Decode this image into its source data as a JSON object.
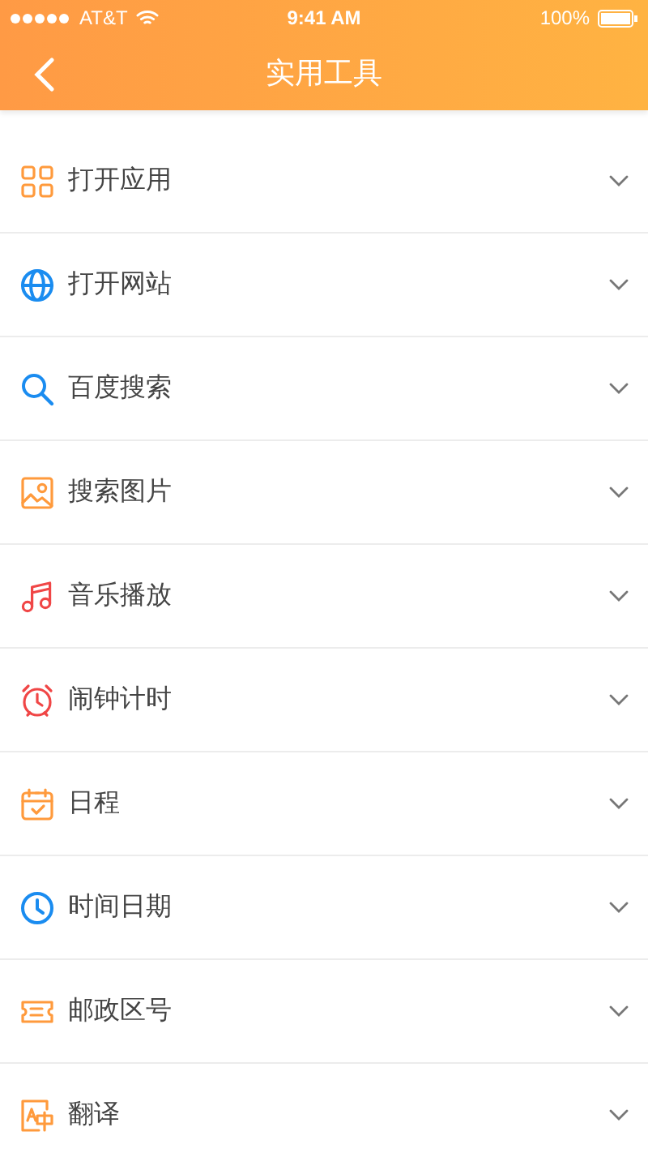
{
  "status_bar": {
    "carrier": "AT&T",
    "time": "9:41 AM",
    "battery": "100%"
  },
  "nav": {
    "title": "实用工具"
  },
  "items": [
    {
      "kind": "apps",
      "label": "打开应用",
      "color": "#ff9a3c"
    },
    {
      "kind": "globe",
      "label": "打开网站",
      "color": "#1a8cf0"
    },
    {
      "kind": "search",
      "label": "百度搜索",
      "color": "#1a8cf0"
    },
    {
      "kind": "image",
      "label": "搜索图片",
      "color": "#ff9a3c"
    },
    {
      "kind": "music",
      "label": "音乐播放",
      "color": "#f04646"
    },
    {
      "kind": "alarm",
      "label": "闹钟计时",
      "color": "#f04646"
    },
    {
      "kind": "calendar",
      "label": "日程",
      "color": "#ff9a3c"
    },
    {
      "kind": "clock",
      "label": "时间日期",
      "color": "#1a8cf0"
    },
    {
      "kind": "ticket",
      "label": "邮政区号",
      "color": "#ff9a3c"
    },
    {
      "kind": "translate",
      "label": "翻译",
      "color": "#ff9a3c"
    }
  ]
}
